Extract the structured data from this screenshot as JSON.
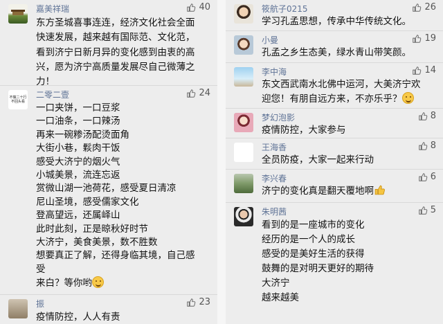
{
  "left_column": [
    {
      "user": "嘉美祥瑞",
      "likes": "40",
      "lines": [
        "东方圣城喜事连连，经济文化社会全面",
        "快速发展，越来越有国际范、文化范，",
        "看到济宁日新月异的变化感到由衷的高",
        "兴，愿为济宁高质量发展尽自己微薄之",
        "力！"
      ]
    },
    {
      "user": "二零二壹",
      "likes": "24",
      "avatar_text": [
        "不做二十行",
        "不回头看"
      ],
      "lines": [
        "一口夹饼，一口豆浆",
        "一口油条，一口辣汤",
        "再来一碗糁汤配烫面角",
        "大街小巷，鬏肉干饭",
        "感受大济宁的烟火气",
        "小城美景，流连忘返",
        "赏微山湖一池荷花，感受夏日清凉",
        "尼山圣境，感受儒家文化",
        "登高望远，还属峄山",
        "此时此刻，正是晾秋好时节",
        "大济宁，美食美景，数不胜数",
        "想要真正了解，还得身临其境，自己感",
        "受",
        "来白？等你哟"
      ]
    },
    {
      "user": "振",
      "likes": "23",
      "lines": [
        "疫情防控，人人有责"
      ]
    }
  ],
  "right_column": [
    {
      "user": "筱航子0215",
      "likes": "26",
      "lines": [
        "学习孔孟思想，传承中华传统文化。"
      ]
    },
    {
      "user": "小曼",
      "likes": "19",
      "lines": [
        "孔孟之乡生态美，绿水青山带笑颜。"
      ]
    },
    {
      "user": "李中海",
      "likes": "14",
      "lines": [
        "东文西武南水北佛中运河，大美济宁欢",
        "迎您！有朋自远方来，不亦乐乎？"
      ]
    },
    {
      "user": "梦幻泡影",
      "likes": "8",
      "lines": [
        "疫情防控，大家参与"
      ]
    },
    {
      "user": "王海香",
      "likes": "8",
      "lines": [
        "全员防疫，大家一起来行动"
      ]
    },
    {
      "user": "李兴春",
      "likes": "6",
      "lines": [
        "济宁的变化真是翻天覆地啊"
      ]
    },
    {
      "user": "朱明茜",
      "likes": "5",
      "lines": [
        "看到的是一座城市的变化",
        "经历的是一个人的成长",
        "感受的是美好生活的获得",
        "鼓舞的是对明天更好的期待",
        "大济宁",
        "越来越美"
      ]
    }
  ],
  "colors": {
    "username": "#5f7396",
    "text": "#111111",
    "background": "#ededed",
    "divider": "#d9d9d9"
  },
  "icons": {
    "like": "thumbs-up-icon",
    "emoji": "smile-emoji-icon"
  }
}
